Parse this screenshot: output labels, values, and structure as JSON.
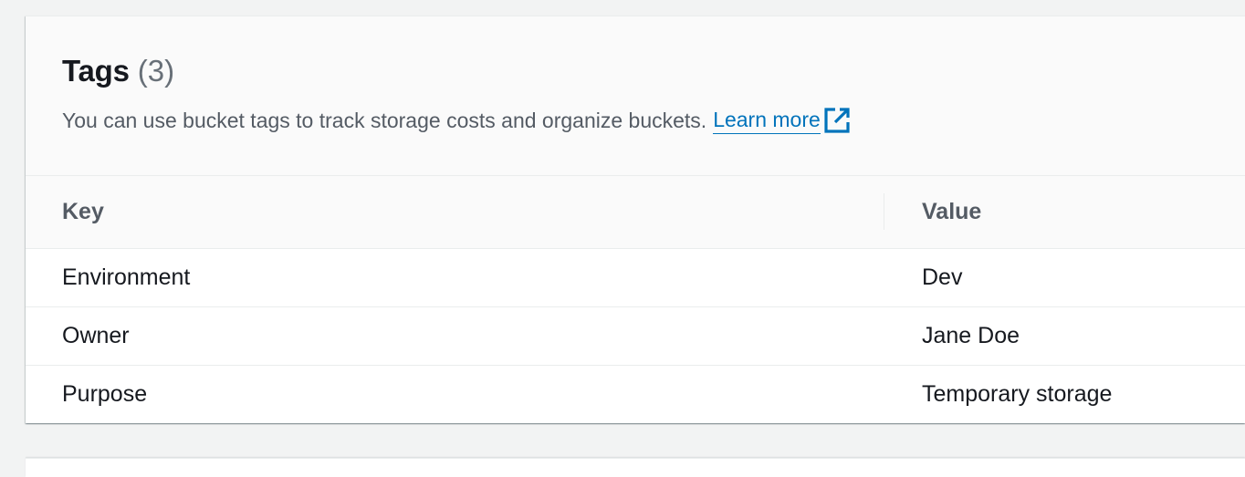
{
  "tags_panel": {
    "title": "Tags",
    "count": "(3)",
    "description": "You can use bucket tags to track storage costs and organize buckets.",
    "learn_more_label": "Learn more",
    "external_icon": "external-link-icon",
    "link_color": "#0073bb",
    "columns": {
      "key": "Key",
      "value": "Value"
    },
    "rows": [
      {
        "key": "Environment",
        "value": "Dev"
      },
      {
        "key": "Owner",
        "value": "Jane Doe"
      },
      {
        "key": "Purpose",
        "value": "Temporary storage"
      }
    ]
  }
}
